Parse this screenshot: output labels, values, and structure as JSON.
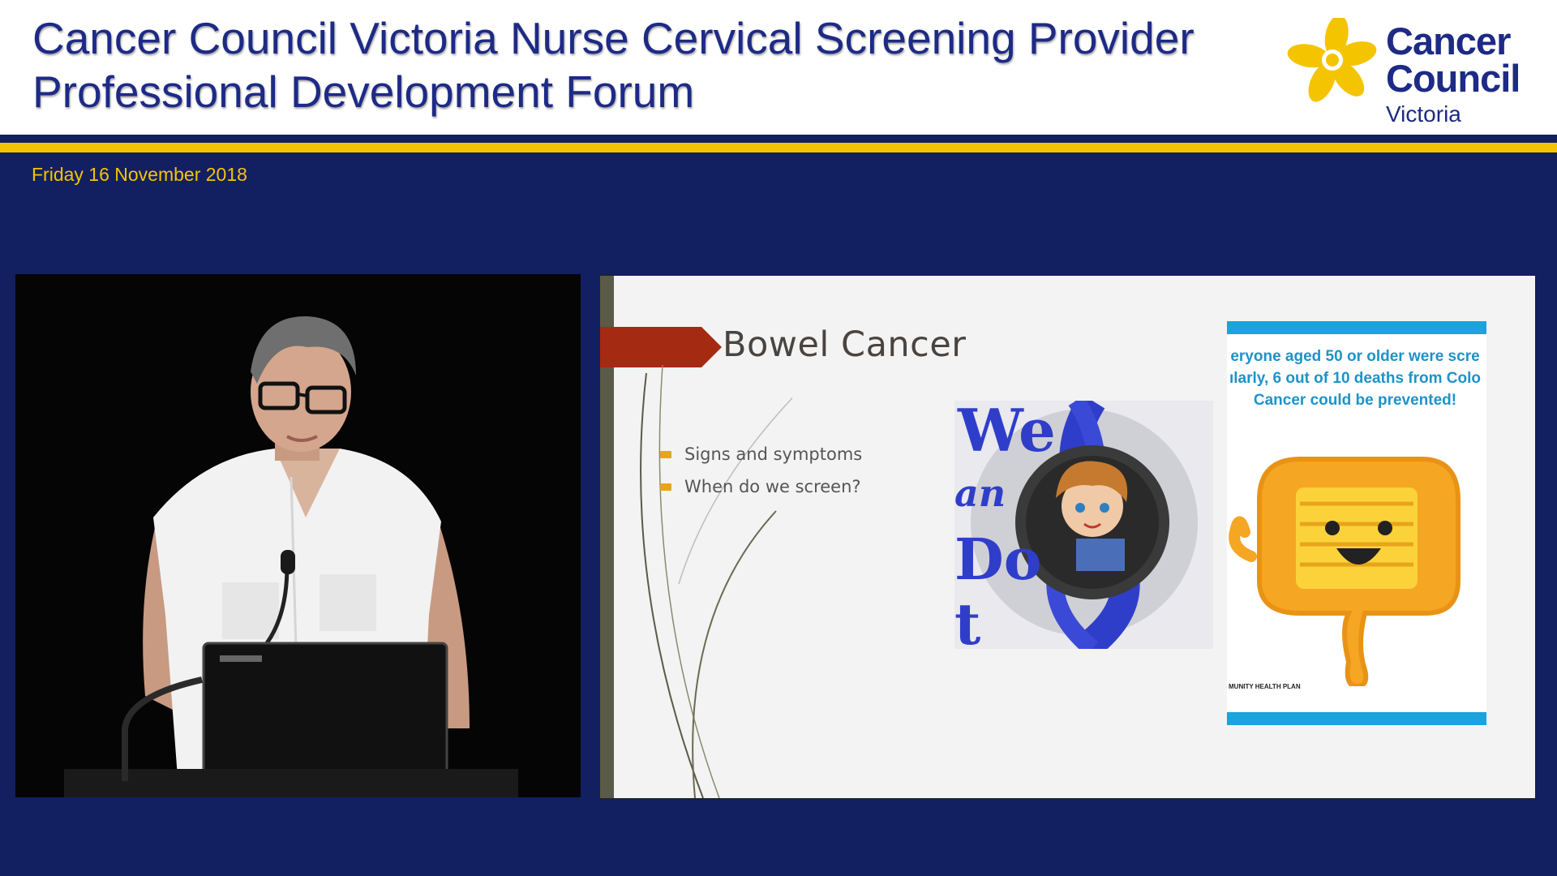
{
  "header": {
    "title_line1": "Cancer Council Victoria Nurse Cervical Screening Provider",
    "title_line2": "Professional Development Forum",
    "logo": {
      "line1": "Cancer",
      "line2": "Council",
      "line3": "Victoria",
      "icon": "daffodil-icon"
    },
    "colors": {
      "navy": "#121f61",
      "gold": "#f5c400",
      "title": "#1d2a86"
    }
  },
  "date": "Friday 16 November 2018",
  "slide": {
    "title": "Bowel Cancer",
    "bullets": [
      "Signs and symptoms",
      "When do we screen?"
    ],
    "poster": {
      "line1": "eryone aged 50 or older were scre",
      "line2": "ılarly, 6 out of 10 deaths from Colo",
      "line3": "Cancer could be prevented!",
      "footer": "MUNITY HEALTH PLAN"
    },
    "images": [
      "we-can-do-it-icon",
      "smiling-colon-icon"
    ]
  },
  "video": {
    "content": "speaker-at-podium"
  }
}
